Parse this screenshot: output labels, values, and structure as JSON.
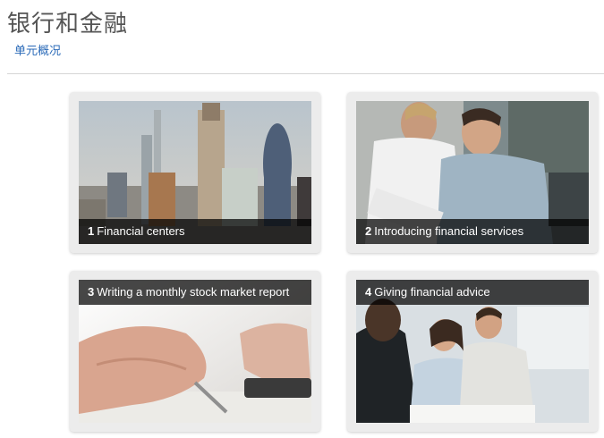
{
  "header": {
    "title": "银行和金融",
    "overview_link": "单元概况"
  },
  "units": [
    {
      "number": "1",
      "title": "Financial centers",
      "image": "city-skyline-photo"
    },
    {
      "number": "2",
      "title": "Introducing financial services",
      "image": "business-meeting-photo"
    },
    {
      "number": "3",
      "title": "Writing a monthly stock market report",
      "image": "hand-writing-photo"
    },
    {
      "number": "4",
      "title": "Giving financial advice",
      "image": "couple-advisor-photo"
    }
  ]
}
